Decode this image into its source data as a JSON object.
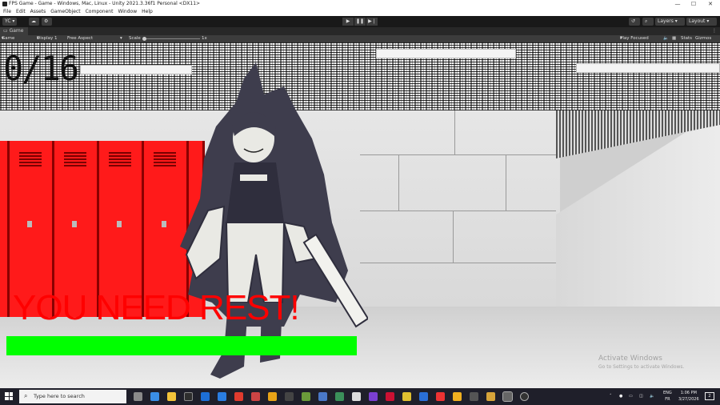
{
  "window": {
    "title": "FPS Game - Game - Windows, Mac, Linux - Unity 2021.3.36f1 Personal <DX11>",
    "min": "—",
    "max": "☐",
    "close": "✕"
  },
  "menu": [
    "File",
    "Edit",
    "Assets",
    "GameObject",
    "Component",
    "Window",
    "Help"
  ],
  "toolbar": {
    "account": "YC ▾",
    "layers": "Layers",
    "layout": "Layout"
  },
  "tab": {
    "label": "Game"
  },
  "gamebar": {
    "mode": "Game",
    "display": "Display 1",
    "aspect": "Free Aspect",
    "scale_label": "Scale",
    "scale_value": "1x",
    "play_focused": "Play Focused",
    "stats": "Stats",
    "gizmos": "Gizmos"
  },
  "hud": {
    "counter": "0/16",
    "message": "YOU NEED REST!",
    "stamina_fraction": 1.0,
    "stamina_color": "#00ff00"
  },
  "watermark": {
    "line1": "Activate Windows",
    "line2": "Go to Settings to activate Windows."
  },
  "taskbar": {
    "search_placeholder": "Type here to search",
    "lang": "ENG",
    "lang2": "FR",
    "time": "1:06 PM",
    "date": "3/27/2026",
    "notifications": "2"
  },
  "colors": {
    "locker": "#ff1a1a",
    "stamina": "#00ff00",
    "message": "#ff0000"
  }
}
